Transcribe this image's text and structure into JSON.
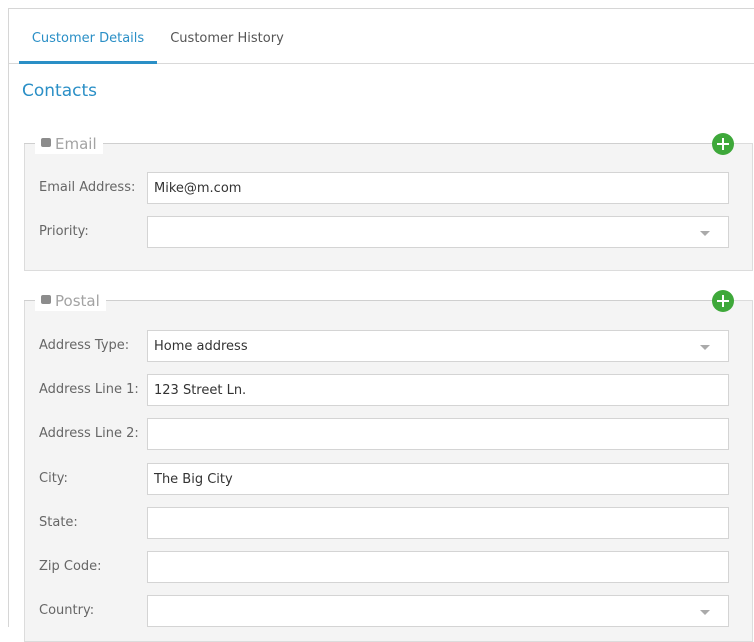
{
  "tabs": [
    {
      "label": "Customer Details"
    },
    {
      "label": "Customer History"
    }
  ],
  "section_title": "Contacts",
  "email_group": {
    "legend": "Email",
    "email_address": {
      "label": "Email Address:",
      "value": "Mike@m.com"
    },
    "priority": {
      "label": "Priority:",
      "value": ""
    }
  },
  "postal_group": {
    "legend": "Postal",
    "address_type": {
      "label": "Address Type:",
      "value": "Home address"
    },
    "address_line_1": {
      "label": "Address Line 1:",
      "value": "123 Street Ln."
    },
    "address_line_2": {
      "label": "Address Line 2:",
      "value": ""
    },
    "city": {
      "label": "City:",
      "value": "The Big City"
    },
    "state": {
      "label": "State:",
      "value": ""
    },
    "zip_code": {
      "label": "Zip Code:",
      "value": ""
    },
    "country": {
      "label": "Country:",
      "value": ""
    }
  },
  "icons": {
    "collapse": "minus-square-icon",
    "add": "plus-circle-icon",
    "dropdown": "caret-down-icon"
  },
  "colors": {
    "accent": "#2a8fc6",
    "add_button": "#3ea83a",
    "group_background": "#f4f4f4"
  }
}
